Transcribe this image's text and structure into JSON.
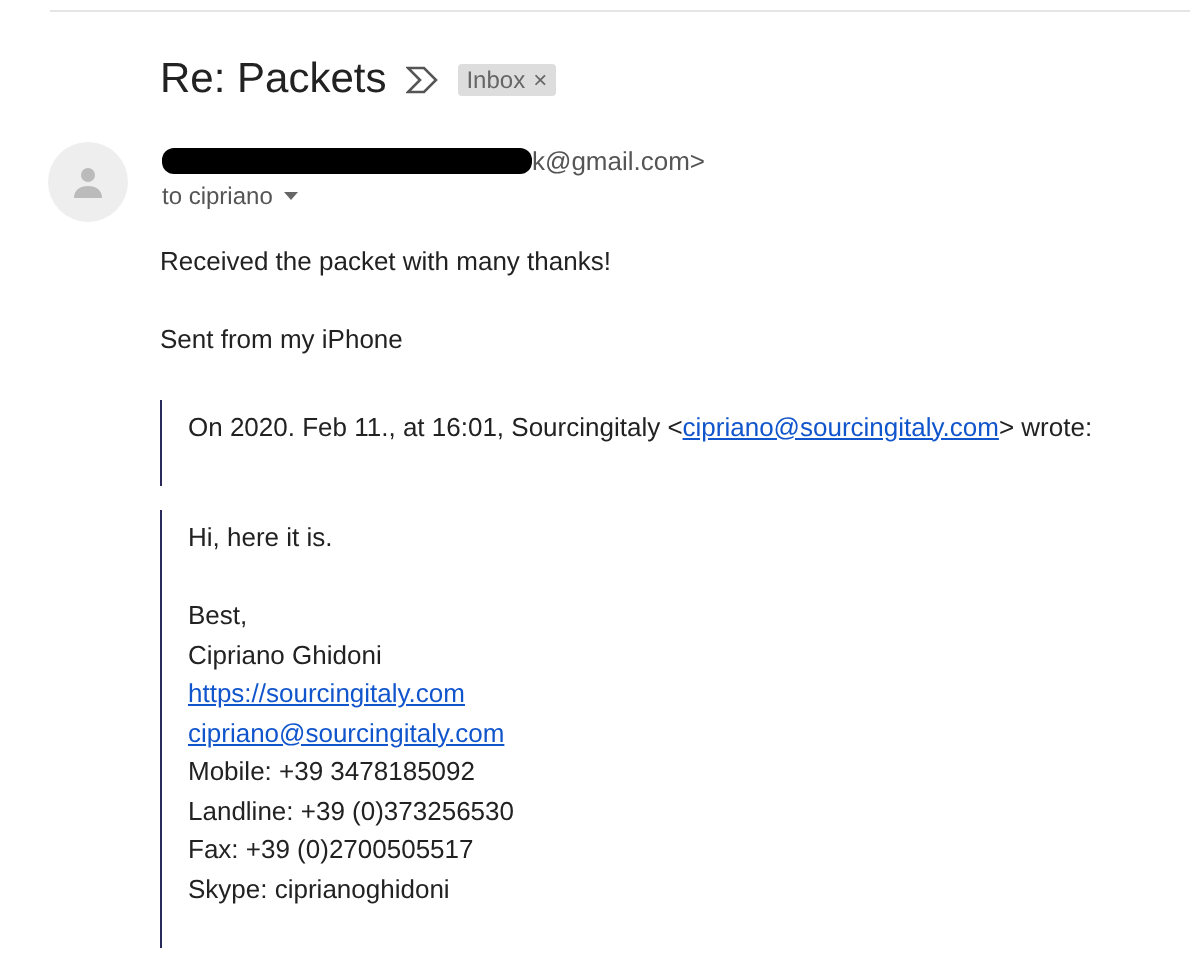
{
  "subject": "Re: Packets",
  "label": {
    "text": "Inbox",
    "remove": "×"
  },
  "sender": {
    "visible_text": "k@gmail.com>",
    "redacted": true
  },
  "recipient": "to cipriano",
  "body": [
    "Received the packet with many thanks!",
    "Sent from my iPhone"
  ],
  "attribution": {
    "before": "On 2020. Feb 11., at 16:01, Sourcingitaly <",
    "email": "cipriano@sourcingitaly.com",
    "after": "> wrote:"
  },
  "quoted": [
    {
      "kind": "text",
      "text": "Hi, here it is."
    },
    {
      "kind": "gap"
    },
    {
      "kind": "text",
      "text": "Best,"
    },
    {
      "kind": "text",
      "text": "Cipriano Ghidoni"
    },
    {
      "kind": "link",
      "text": "https://sourcingitaly.com"
    },
    {
      "kind": "link",
      "text": "cipriano@sourcingitaly.com"
    },
    {
      "kind": "text",
      "text": "Mobile: +39 3478185092"
    },
    {
      "kind": "text",
      "text": "Landline: +39 (0)373256530"
    },
    {
      "kind": "text",
      "text": "Fax: +39 (0)2700505517"
    },
    {
      "kind": "text",
      "text": "Skype: ciprianoghidoni"
    }
  ]
}
